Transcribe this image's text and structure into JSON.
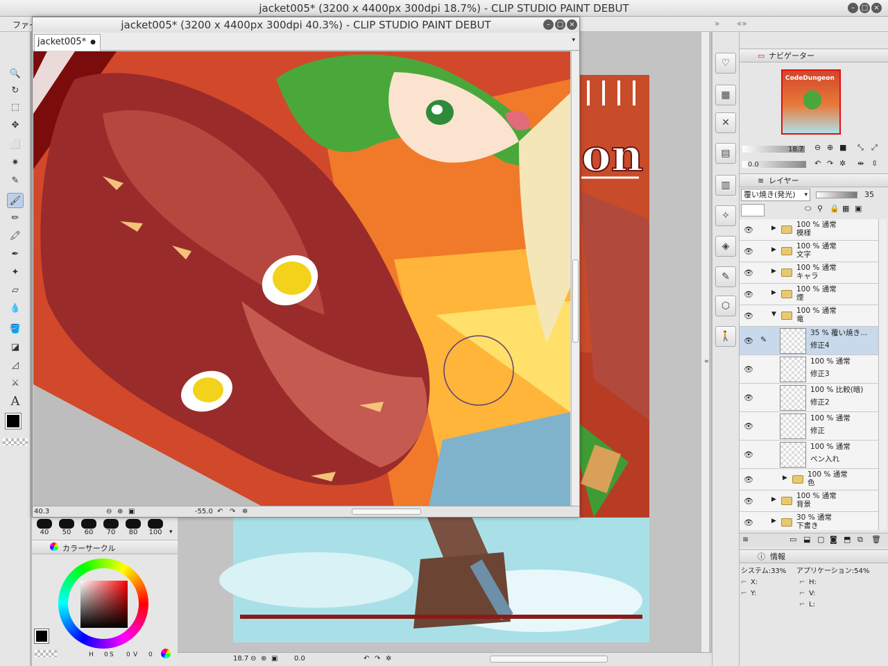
{
  "main_window": {
    "title": "jacket005* (3200 x 4400px 300dpi 18.7%)  - CLIP STUDIO PAINT DEBUT",
    "min_icon": "minimize-icon",
    "max_icon": "maximize-icon",
    "close_icon": "close-icon"
  },
  "menu": {
    "first_item": "ファイ"
  },
  "sub_window": {
    "title": "jacket005* (3200 x 4400px 300dpi 40.3%)  - CLIP STUDIO PAINT DEBUT",
    "tab_label": "jacket005*",
    "tab_dot": "●",
    "zoom": "40.3",
    "angle": "-55.0"
  },
  "main_canvas_status": {
    "zoom": "18.7",
    "angle": "0.0"
  },
  "brush_sizes": [
    "40",
    "50",
    "60",
    "70",
    "80",
    "100"
  ],
  "color_panel": {
    "title": "カラーサークル",
    "h_label": "H",
    "h_value": "0",
    "s_label": "S",
    "s_value": "0",
    "v_label": "V",
    "v_value": "0",
    "fg_color": "#000000"
  },
  "navigator": {
    "title": "ナビゲーター",
    "zoom": "18.7",
    "angle": "0.0",
    "thumb_text": "CodeDungeon"
  },
  "layer_panel": {
    "title": "レイヤー",
    "blend_mode": "覆い焼き(発光)",
    "opacity": "35",
    "layers": [
      {
        "pct": "100 %",
        "mode": "通常",
        "name": "模様",
        "type": "folder",
        "expanded": false
      },
      {
        "pct": "100 %",
        "mode": "通常",
        "name": "文字",
        "type": "folder",
        "expanded": false
      },
      {
        "pct": "100 %",
        "mode": "通常",
        "name": "キャラ",
        "type": "folder",
        "expanded": false
      },
      {
        "pct": "100 %",
        "mode": "通常",
        "name": "煙",
        "type": "folder",
        "expanded": false
      },
      {
        "pct": "100 %",
        "mode": "通常",
        "name": "竜",
        "type": "folder",
        "expanded": true
      },
      {
        "pct": "35 %",
        "mode": "覆い焼き…",
        "name": "修正4",
        "type": "layer",
        "selected": true
      },
      {
        "pct": "100 %",
        "mode": "通常",
        "name": "修正3",
        "type": "layer"
      },
      {
        "pct": "100 %",
        "mode": "比較(暗)",
        "name": "修正2",
        "type": "layer"
      },
      {
        "pct": "100 %",
        "mode": "通常",
        "name": "修正",
        "type": "layer"
      },
      {
        "pct": "100 %",
        "mode": "通常",
        "name": "ペン入れ",
        "type": "layer"
      },
      {
        "pct": "100 %",
        "mode": "通常",
        "name": "色",
        "type": "folder",
        "expanded": false
      },
      {
        "pct": "100 %",
        "mode": "通常",
        "name": "背景",
        "type": "folder",
        "expanded": false
      },
      {
        "pct": "30 %",
        "mode": "通常",
        "name": "下書き",
        "type": "folder",
        "expanded": false
      }
    ]
  },
  "info_panel": {
    "title": "情報",
    "system": "システム:33%",
    "app": "アプリケーション:54%",
    "x": "X:",
    "y": "Y:",
    "h": "H:",
    "v": "V:",
    "l": "L:"
  },
  "colors": {
    "accent": "#c9d9ec",
    "dragon": "#9a2b2b",
    "hair": "#4aa83a"
  }
}
